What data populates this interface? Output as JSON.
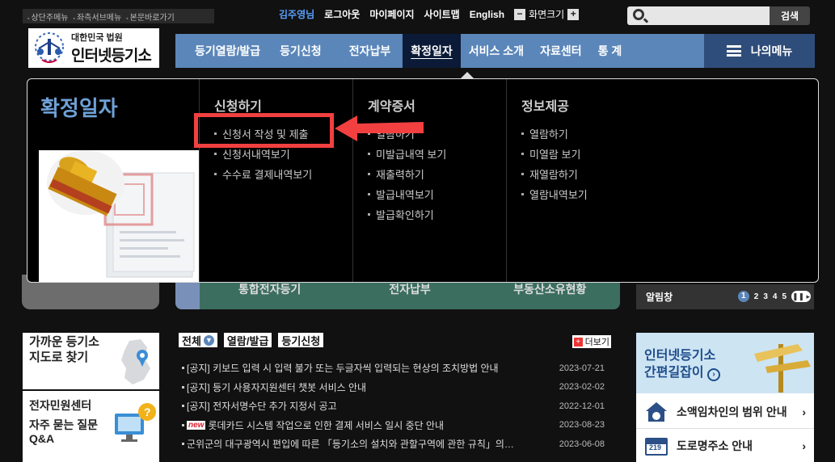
{
  "skip_links": [
    "상단주메뉴",
    "좌측서브메뉴",
    "본문바로가기"
  ],
  "util": {
    "user": "김주영님",
    "logout": "로그아웃",
    "mypage": "마이페이지",
    "sitemap": "사이트맵",
    "english": "English",
    "font_size": "화면크기",
    "minus": "−",
    "plus": "+"
  },
  "search": {
    "placeholder": "",
    "button": "검색"
  },
  "logo": {
    "small": "대한민국 법원",
    "large": "인터넷등기소"
  },
  "nav": {
    "items": [
      "등기열람/발급",
      "등기신청",
      "전자납부",
      "확정일자",
      "서비스 소개",
      "자료센터",
      "통 계"
    ],
    "active": "확정일자",
    "my_menu": "나의메뉴"
  },
  "dropdown": {
    "title": "확정일자",
    "columns": [
      {
        "heading": "신청하기",
        "items": [
          "신청서 작성 및 제출",
          "신청서내역보기",
          "수수료 결제내역보기"
        ]
      },
      {
        "heading": "계약증서",
        "items": [
          "열람하기",
          "미발급내역 보기",
          "재출력하기",
          "발급내역보기",
          "발급확인하기"
        ]
      },
      {
        "heading": "정보제공",
        "items": [
          "열람하기",
          "미열람 보기",
          "재열람하기",
          "열람내역보기"
        ]
      }
    ]
  },
  "under": {
    "mid_segments": [
      "통합전자등기",
      "전자납부",
      "부동산소유현황"
    ],
    "alert_label": "알림창",
    "pages": [
      "1",
      "2",
      "3",
      "4",
      "5"
    ],
    "pause": "❚❚ ▸"
  },
  "left_panel": {
    "nearby_line1": "가까운 등기소",
    "nearby_line2": "지도로 찾기",
    "e_center": "전자민원센터",
    "faq_line1": "자주 묻는 질문",
    "faq_line2": "Q&A"
  },
  "news": {
    "tabs": [
      "전체",
      "열람/발급",
      "등기신청"
    ],
    "more": "더보기",
    "items": [
      {
        "text": "[공지] 키보드 입력 시 입력 불가 또는 두글자씩 입력되는 현상의 조치방법 안내",
        "date": "2023-07-21",
        "new": ""
      },
      {
        "text": "[공지] 등기 사용자지원센터 챗봇 서비스 안내",
        "date": "2023-02-02",
        "new": ""
      },
      {
        "text": "[공지] 전자서명수단 추가 지정서 공고",
        "date": "2022-12-01",
        "new": ""
      },
      {
        "text": "롯데카드 시스템 작업으로 인한 결제 서비스 일시 중단 안내",
        "date": "2023-08-23",
        "new": "new"
      },
      {
        "text": "군위군의 대구광역시 편입에 따른 「등기소의 설치와 관할구역에 관한 규칙」의…",
        "date": "2023-06-08",
        "new": ""
      }
    ]
  },
  "right_panel": {
    "guide_line1": "인터넷등기소",
    "guide_line2": "간편길잡이",
    "row1": "소액임차인의 범위 안내",
    "row2": "도로명주소 안내",
    "road_num": "219"
  },
  "colors": {
    "nav": "#5b86b9",
    "active_nav": "#0b1a36",
    "accent_red": "#f24040",
    "title_blue": "#6ea0d6"
  }
}
